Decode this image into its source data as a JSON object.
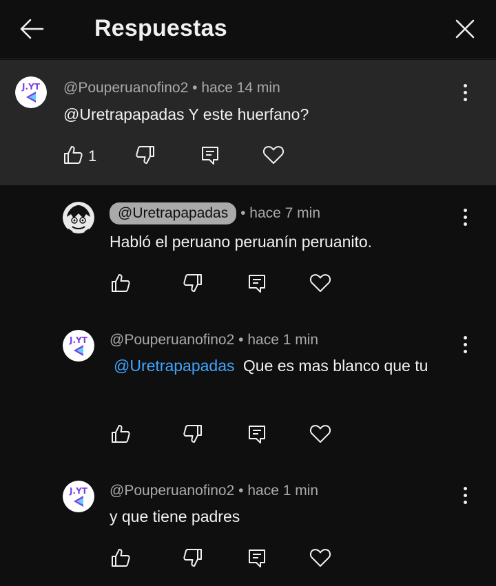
{
  "header": {
    "title": "Respuestas"
  },
  "parent": {
    "author": "@Pouperuanofino2",
    "separator": "•",
    "time": "hace 14 min",
    "text": "@Uretrapapadas Y este huerfano?",
    "like_count": "1",
    "avatar_text": "J.YT"
  },
  "replies": [
    {
      "author": "@Uretrapapadas",
      "separator": "•",
      "time": "hace 7 min",
      "text": "Habló el peruano peruanín peruanito."
    },
    {
      "author": "@Pouperuanofino2",
      "separator": "•",
      "time": "hace 1 min",
      "mention": "@Uretrapapadas",
      "text": "Que es mas blanco que tu",
      "avatar_text": "J.YT"
    },
    {
      "author": "@Pouperuanofino2",
      "separator": "•",
      "time": "hace 1 min",
      "text": "y que tiene padres",
      "avatar_text": "J.YT"
    }
  ],
  "icons": {
    "back": "arrow-left-icon",
    "close": "close-icon",
    "like": "thumb-up-icon",
    "dislike": "thumb-down-icon",
    "reply": "reply-icon",
    "heart": "heart-icon",
    "more": "more-vertical-icon"
  },
  "colors": {
    "background": "#0f0f0f",
    "highlight": "#272727",
    "mention": "#3ea6ff",
    "secondary_text": "#aaaaaa",
    "avatar_purple": "#7b3fe4"
  }
}
